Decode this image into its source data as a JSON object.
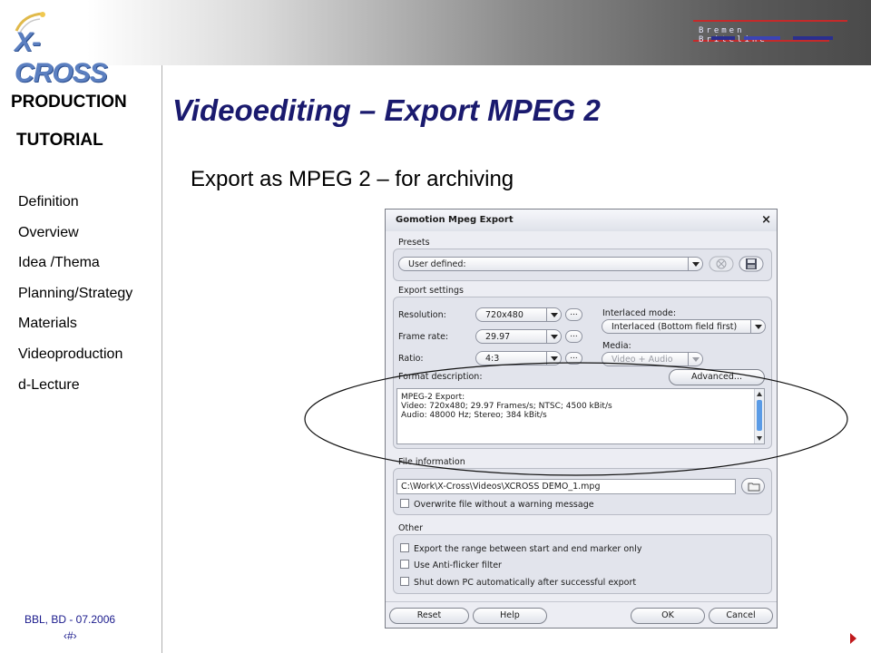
{
  "header": {
    "logo_text": "X-CROSS",
    "brand": "Bremen Briteline",
    "colors": {
      "brand_line": "#c52a2a",
      "logo": "#5b7fc0"
    }
  },
  "sidebar": {
    "title_line1": "PRODUCTION",
    "title_line2": "TUTORIAL",
    "items": [
      {
        "label": "Definition"
      },
      {
        "label": "Overview"
      },
      {
        "label": "Idea /Thema"
      },
      {
        "label": "Planning/Strategy"
      },
      {
        "label": "Materials"
      },
      {
        "label": "Videoproduction"
      },
      {
        "label": "d-Lecture"
      }
    ],
    "footer": "BBL, BD - 07.2006",
    "page_number": "‹#›"
  },
  "slide": {
    "title": "Videoediting – Export MPEG 2",
    "subtitle": "Export as MPEG 2 – for archiving",
    "title_color": "#1a1a6e"
  },
  "dialog": {
    "title": "Gomotion Mpeg Export",
    "close_glyph": "×",
    "presets": {
      "label": "Presets",
      "value": "User defined:"
    },
    "export_settings": {
      "label": "Export settings",
      "resolution_label": "Resolution:",
      "resolution_value": "720x480",
      "frame_rate_label": "Frame rate:",
      "frame_rate_value": "29.97",
      "ratio_label": "Ratio:",
      "ratio_value": "4:3",
      "more_label": "...",
      "interlaced_label": "Interlaced mode:",
      "interlaced_value": "Interlaced (Bottom field first)",
      "media_label": "Media:",
      "media_value": "Video + Audio",
      "format_description_label": "Format description:",
      "advanced_label": "Advanced...",
      "format_lines": [
        "MPEG-2 Export:",
        "Video: 720x480; 29.97 Frames/s; NTSC; 4500 kBit/s",
        "Audio: 48000 Hz; Stereo; 384 kBit/s"
      ]
    },
    "file_information": {
      "label": "File information",
      "path": "C:\\Work\\X-Cross\\Videos\\XCROSS DEMO_1.mpg",
      "overwrite_label": "Overwrite file without a warning message"
    },
    "other": {
      "label": "Other",
      "options": [
        "Export the range between start and end marker only",
        "Use Anti-flicker filter",
        "Shut down PC automatically after successful export"
      ]
    },
    "buttons": {
      "reset": "Reset",
      "help": "Help",
      "ok": "OK",
      "cancel": "Cancel"
    }
  }
}
